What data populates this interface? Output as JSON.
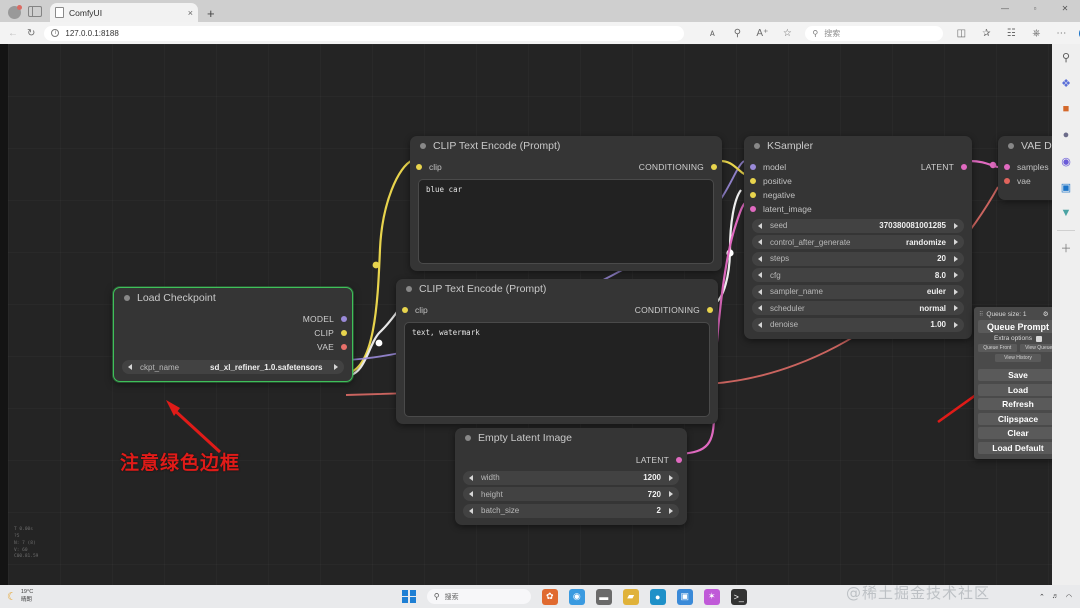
{
  "browser": {
    "tab": {
      "title": "ComfyUI",
      "close_label": "×"
    },
    "new_tab_label": "+",
    "url": "127.0.0.1:8188",
    "search_placeholder": "搜索",
    "window_controls": {
      "minimize": "—",
      "maximize": "▫",
      "close": "✕"
    },
    "nav": {
      "back": "←",
      "forward": "→",
      "reload": "↻"
    },
    "toolbar_icons": [
      "read-aloud-icon",
      "find-icon",
      "font-style-icon",
      "favorite-icon"
    ],
    "right_icons": [
      "split-screen-icon",
      "collections-icon",
      "browser-essentials-icon",
      "extensions-icon",
      "more-icon"
    ]
  },
  "sidebar": {
    "items": [
      {
        "name": "search-icon",
        "glyph": "🔍",
        "color": "#5b5b5b"
      },
      {
        "name": "shopping-tag-icon",
        "glyph": "🔖",
        "color": "#5b6fd8"
      },
      {
        "name": "tools-icon",
        "glyph": "💼",
        "color": "#d4682a"
      },
      {
        "name": "games-icon",
        "glyph": "🕹",
        "color": "#6c6c8a"
      },
      {
        "name": "copilot-icon",
        "glyph": "◉",
        "color": "#6a5bd8"
      },
      {
        "name": "outlook-icon",
        "glyph": "▣",
        "color": "#1a73c8"
      },
      {
        "name": "shopping-cart-icon",
        "glyph": "🛒",
        "color": "#4aa3a3"
      },
      {
        "name": "add-icon",
        "glyph": "＋",
        "color": "#777"
      }
    ]
  },
  "canvas": {
    "stats": "T 0.00s\n?5\nN: 7 (8)\nV: 60\nC00.81.59",
    "annotation": "注意绿色边框",
    "annotation_color": "#e01b18"
  },
  "nodes": {
    "clip_positive": {
      "title": "CLIP Text Encode (Prompt)",
      "input_port": "clip",
      "output_port": "CONDITIONING",
      "text": "blue car"
    },
    "clip_negative": {
      "title": "CLIP Text Encode (Prompt)",
      "input_port": "clip",
      "output_port": "CONDITIONING",
      "text": "text, watermark"
    },
    "ksampler": {
      "title": "KSampler",
      "inputs": [
        "model",
        "positive",
        "negative",
        "latent_image"
      ],
      "output": "LATENT",
      "widgets": [
        {
          "name": "seed",
          "value": "370380081001285"
        },
        {
          "name": "control_after_generate",
          "value": "randomize"
        },
        {
          "name": "steps",
          "value": "20"
        },
        {
          "name": "cfg",
          "value": "8.0"
        },
        {
          "name": "sampler_name",
          "value": "euler"
        },
        {
          "name": "scheduler",
          "value": "normal"
        },
        {
          "name": "denoise",
          "value": "1.00"
        }
      ]
    },
    "load_checkpoint": {
      "title": "Load Checkpoint",
      "outputs": [
        "MODEL",
        "CLIP",
        "VAE"
      ],
      "widgets": [
        {
          "name": "ckpt_name",
          "value": "sd_xl_refiner_1.0.safetensors"
        }
      ],
      "selected": true,
      "border_color": "#3fbf5a"
    },
    "empty_latent": {
      "title": "Empty Latent Image",
      "output": "LATENT",
      "widgets": [
        {
          "name": "width",
          "value": "1200"
        },
        {
          "name": "height",
          "value": "720"
        },
        {
          "name": "batch_size",
          "value": "2"
        }
      ]
    },
    "vae_decode": {
      "title": "VAE Deco",
      "inputs": [
        "samples",
        "vae"
      ]
    }
  },
  "queue_menu": {
    "queue_size_label": "Queue size: 1",
    "gear_icon": "⚙",
    "close_icon": "✕",
    "queue_prompt": "Queue Prompt",
    "extra_options": "Extra options",
    "queue_front": "Queue Front",
    "view_queue": "View Queue",
    "view_history": "View History",
    "buttons": [
      "Save",
      "Load",
      "Refresh",
      "Clipspace",
      "Clear",
      "Load Default"
    ]
  },
  "taskbar": {
    "weather_temp": "19°C",
    "weather_desc": "晴朗",
    "search_placeholder": "搜索",
    "apps": [
      {
        "name": "widgets-icon",
        "glyph": "✿",
        "color": "#e06a30"
      },
      {
        "name": "chrome-icon",
        "glyph": "◉",
        "color": "#3a9ae0"
      },
      {
        "name": "file-explorer-icon",
        "glyph": "▬",
        "color": "#6a6a6a"
      },
      {
        "name": "folder-icon",
        "glyph": "▰",
        "color": "#e0b23a"
      },
      {
        "name": "edge-icon",
        "glyph": "●",
        "color": "#1e90c8"
      },
      {
        "name": "store-icon",
        "glyph": "▣",
        "color": "#3a8ad8"
      },
      {
        "name": "star-app-icon",
        "glyph": "✦",
        "color": "#c05ad8"
      },
      {
        "name": "terminal-icon",
        "glyph": "⌫",
        "color": "#333333"
      }
    ],
    "tray": [
      "⌃",
      "🔊",
      "📶"
    ]
  },
  "watermark": "@稀土掘金技术社区"
}
